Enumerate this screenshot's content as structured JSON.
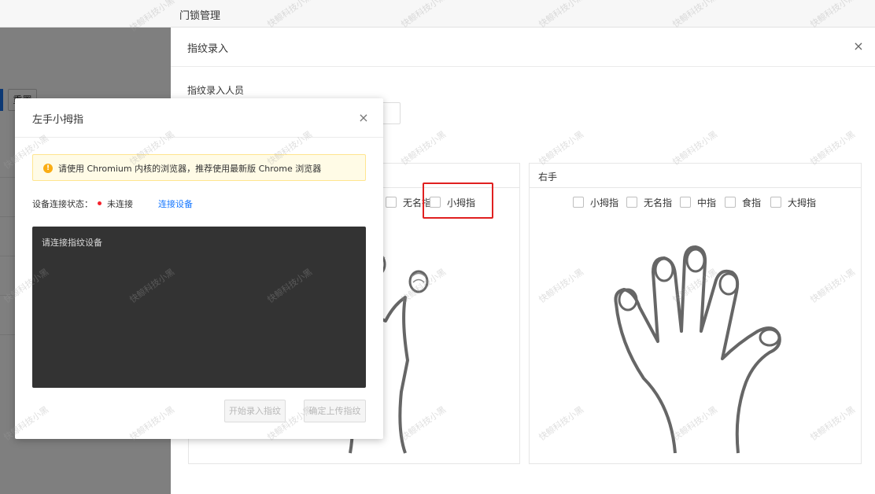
{
  "topbar": {
    "title": "门锁管理"
  },
  "background": {
    "reset_label": "重置"
  },
  "drawer": {
    "title": "指纹录入",
    "close_icon": "×",
    "person_label": "指纹录入人员",
    "left_hand": {
      "fingers": [
        "无名指",
        "小拇指"
      ]
    },
    "right_hand": {
      "title": "右手",
      "fingers": [
        "小拇指",
        "无名指",
        "中指",
        "食指",
        "大拇指"
      ]
    }
  },
  "modal": {
    "title": "左手小拇指",
    "close_icon": "×",
    "alert_icon": "!",
    "alert_text": "请使用 Chromium 内核的浏览器，推荐使用最新版 Chrome 浏览器",
    "status_label": "设备连接状态：",
    "status_value": "未连接",
    "connect_link": "连接设备",
    "device_screen_text": "请连接指纹设备",
    "start_button": "开始录入指纹",
    "upload_button": "确定上传指纹"
  },
  "watermark": "快鲸科技小黑",
  "colors": {
    "link": "#1677ff",
    "status_dot": "#f5222d",
    "alert_bg": "#fffbe6",
    "highlight": "#e02020",
    "device_screen": "#333333"
  },
  "icons": {
    "warning": "warning-circle-icon",
    "close": "close-icon"
  }
}
